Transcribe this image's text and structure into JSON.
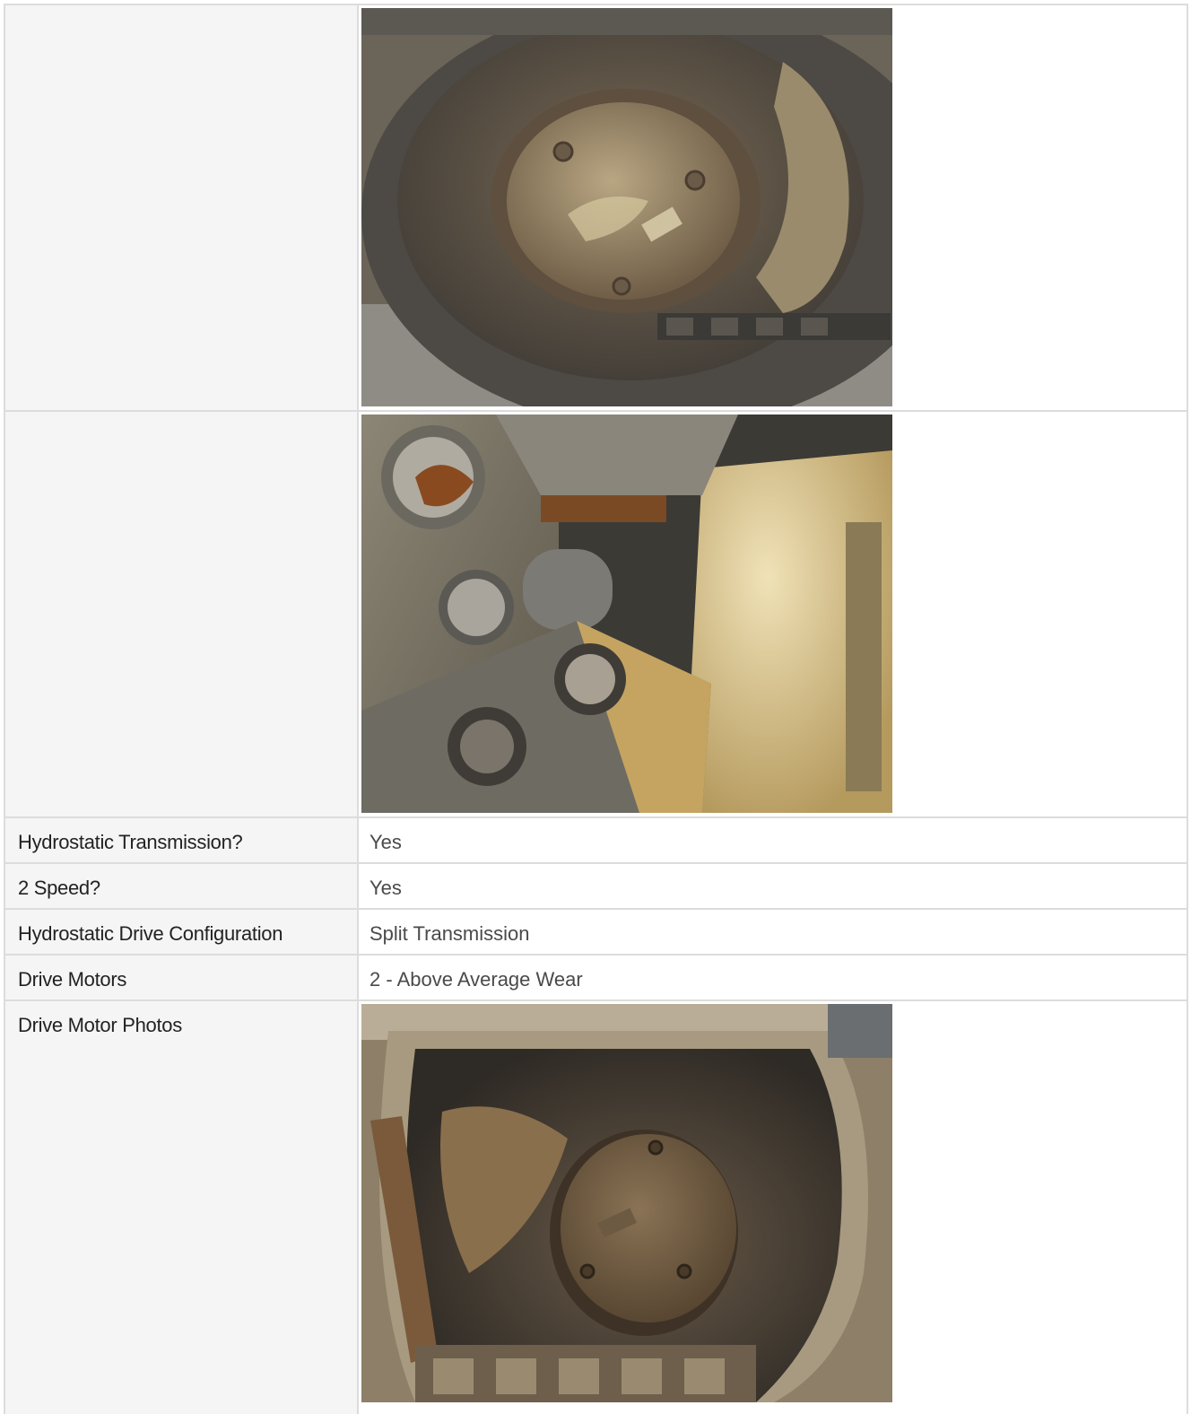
{
  "rows": [
    {
      "label": "Hydrostatic Transmission?",
      "value": "Yes"
    },
    {
      "label": "2 Speed?",
      "value": "Yes"
    },
    {
      "label": "Hydrostatic Drive Configuration",
      "value": "Split Transmission"
    },
    {
      "label": "Drive Motors",
      "value": "2 - Above Average Wear"
    },
    {
      "label": "Drive Motor Photos"
    }
  ],
  "photos": [
    {
      "icon": "drive-motor-sprocket-photo"
    },
    {
      "icon": "engine-bay-bolts-photo"
    },
    {
      "icon": "drive-motor-track-photo"
    }
  ],
  "colors": {
    "label_bg": "#f5f5f5",
    "border": "#dcdcdc",
    "label_text": "#222222",
    "value_text": "#4a4a4a"
  }
}
